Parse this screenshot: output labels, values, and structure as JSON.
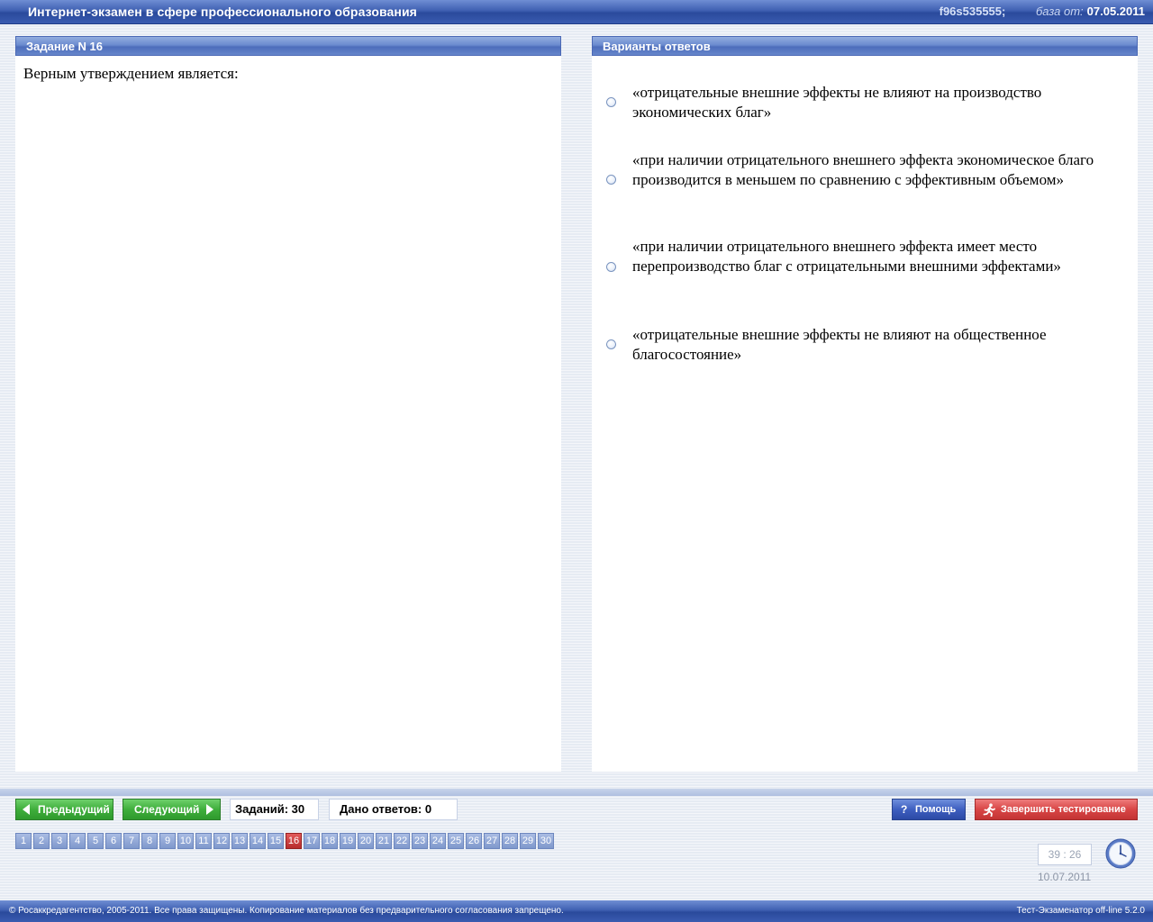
{
  "titlebar": {
    "title": "Интернет-экзамен в сфере профессионального образования",
    "code": "f96s535555;",
    "base_label": "база от:",
    "base_date": "07.05.2011"
  },
  "question": {
    "header": "Задание N 16",
    "text": "Верным утверждением является:"
  },
  "answers": {
    "header": "Варианты ответов",
    "options": [
      {
        "text": "«отрицательные внешние эффекты не влияют на производство экономических благ»",
        "selected": false
      },
      {
        "text": "«при наличии отрицательного внешнего эффекта экономическое благо производится в меньшем по сравнению с эффективным объемом»",
        "selected": false
      },
      {
        "text": "«при наличии отрицательного внешнего эффекта имеет место перепроизводство благ с отрицательными  внешними эффектами»",
        "selected": false
      },
      {
        "text": "«отрицательные внешние эффекты не влияют на общественное благосостояние»",
        "selected": false
      }
    ]
  },
  "nav": {
    "prev_label": "Предыдущий",
    "next_label": "Следующий",
    "tasks_label": "Заданий: 30",
    "answered_label": "Дано ответов: 0",
    "help_label": "Помощь",
    "finish_label": "Завершить тестирование"
  },
  "pages": [
    "1",
    "2",
    "3",
    "4",
    "5",
    "6",
    "7",
    "8",
    "9",
    "10",
    "11",
    "12",
    "13",
    "14",
    "15",
    "16",
    "17",
    "18",
    "19",
    "20",
    "21",
    "22",
    "23",
    "24",
    "25",
    "26",
    "27",
    "28",
    "29",
    "30"
  ],
  "current_page": "16",
  "timer": {
    "time": "39 : 26",
    "date": "10.07.2011"
  },
  "footer": {
    "copyright": "© Росаккредагентство, 2005-2011. Все права защищены. Копирование материалов без предварительного согласования запрещено.",
    "version": "Тест-Экзаменатор off-line 5.2.0"
  },
  "colors": {
    "titlebar": "#3f60b2",
    "nav_green": "#3fae3c",
    "help_blue": "#3e5fc0",
    "finish_red": "#d84646",
    "current_page_red": "#c43434"
  }
}
